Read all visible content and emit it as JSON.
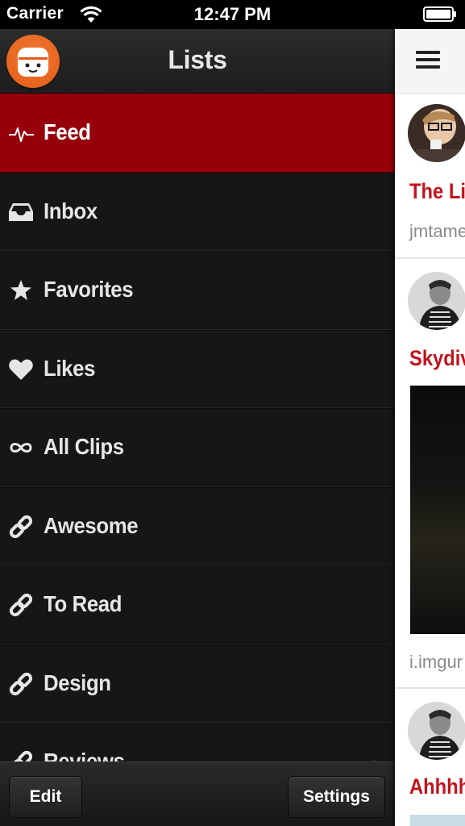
{
  "status_bar": {
    "carrier": "Carrier",
    "time": "12:47 PM",
    "icons": [
      "wifi-icon",
      "battery-icon"
    ]
  },
  "sidebar": {
    "title": "Lists",
    "logo_icon": "kippt-logo-icon",
    "items": [
      {
        "label": "Feed",
        "icon": "pulse-icon",
        "active": true
      },
      {
        "label": "Inbox",
        "icon": "inbox-tray-icon",
        "active": false
      },
      {
        "label": "Favorites",
        "icon": "star-icon",
        "active": false
      },
      {
        "label": "Likes",
        "icon": "heart-icon",
        "active": false
      },
      {
        "label": "All Clips",
        "icon": "infinity-icon",
        "active": false
      },
      {
        "label": "Awesome",
        "icon": "link-icon",
        "active": false
      },
      {
        "label": "To Read",
        "icon": "link-icon",
        "active": false
      },
      {
        "label": "Design",
        "icon": "link-icon",
        "active": false
      },
      {
        "label": "Reviews",
        "icon": "link-icon",
        "active": false,
        "locked": true
      }
    ],
    "footer": {
      "edit_label": "Edit",
      "settings_label": "Settings"
    }
  },
  "content": {
    "menu_icon": "hamburger-menu-icon",
    "posts": [
      {
        "title": "The Li",
        "source": "jmtame"
      },
      {
        "title": "Skydiv",
        "source": "i.imgur"
      },
      {
        "title": "Ahhhh"
      }
    ]
  },
  "colors": {
    "active_red": "#96000a",
    "accent_red": "#c3141e",
    "logo_orange": "#e35b16",
    "sidebar_bg": "#161616"
  }
}
